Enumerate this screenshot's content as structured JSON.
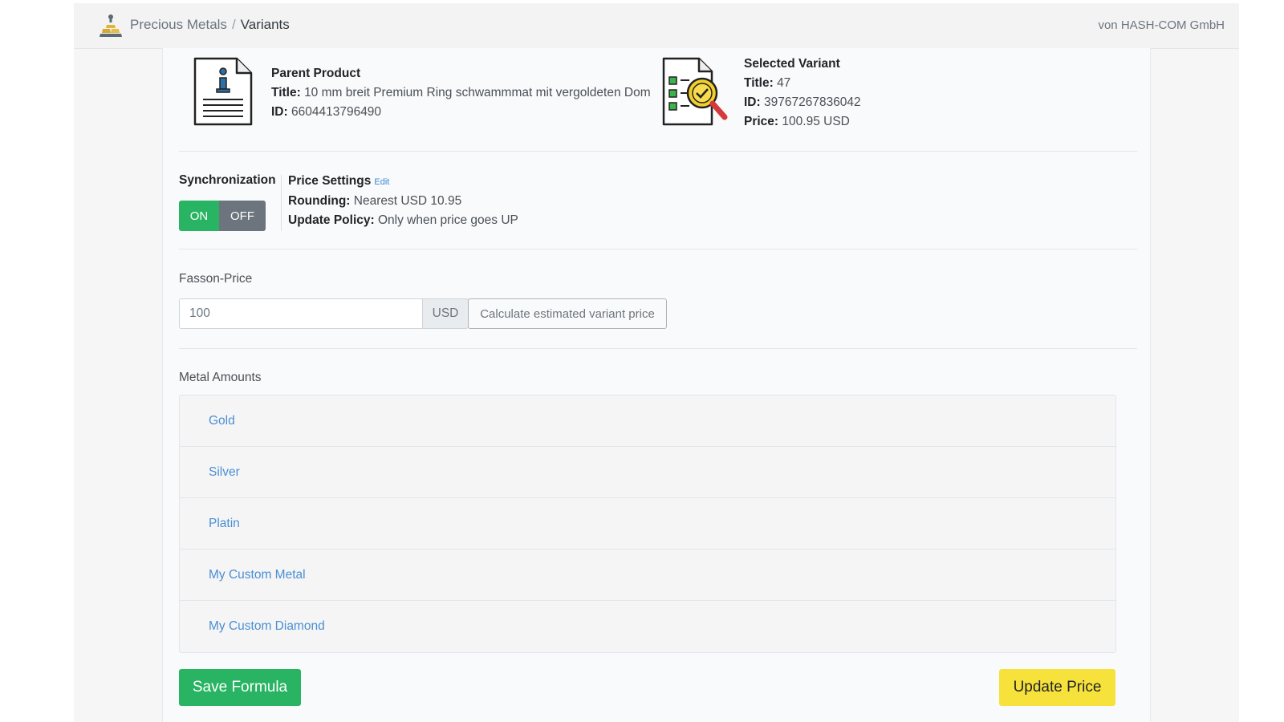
{
  "header": {
    "app_name": "Precious Metals",
    "separator": "/",
    "current_page": "Variants",
    "vendor": "von HASH-COM GmbH"
  },
  "parent_product": {
    "heading": "Parent Product",
    "title_label": "Title:",
    "title_value": "10 mm breit Premium Ring schwammmat mit vergoldeten Dom",
    "id_label": "ID:",
    "id_value": "6604413796490"
  },
  "selected_variant": {
    "heading": "Selected Variant",
    "title_label": "Title:",
    "title_value": "47",
    "id_label": "ID:",
    "id_value": "39767267836042",
    "price_label": "Price:",
    "price_value": "100.95 USD"
  },
  "synchronization": {
    "label": "Synchronization",
    "on_label": "ON",
    "off_label": "OFF",
    "state": "ON"
  },
  "price_settings": {
    "heading": "Price Settings",
    "edit_label": "Edit",
    "rounding_label": "Rounding:",
    "rounding_value": "Nearest USD 10.95",
    "policy_label": "Update Policy:",
    "policy_value": "Only when price goes UP"
  },
  "fasson_price": {
    "label": "Fasson-Price",
    "value": "100",
    "currency": "USD",
    "calculate_label": "Calculate estimated variant price"
  },
  "metal_amounts": {
    "label": "Metal Amounts",
    "items": [
      {
        "label": "Gold"
      },
      {
        "label": "Silver"
      },
      {
        "label": "Platin"
      },
      {
        "label": "My Custom Metal"
      },
      {
        "label": "My Custom Diamond"
      }
    ]
  },
  "actions": {
    "save_label": "Save Formula",
    "update_label": "Update Price"
  },
  "colors": {
    "accent_green": "#28b463",
    "accent_yellow": "#f7e23b",
    "link_blue": "#4a8fd3",
    "toggle_off_gray": "#6c757d"
  },
  "icons": {
    "logo": "gold-bars-logo-icon",
    "parent": "document-info-icon",
    "variant": "checklist-magnifier-icon"
  }
}
